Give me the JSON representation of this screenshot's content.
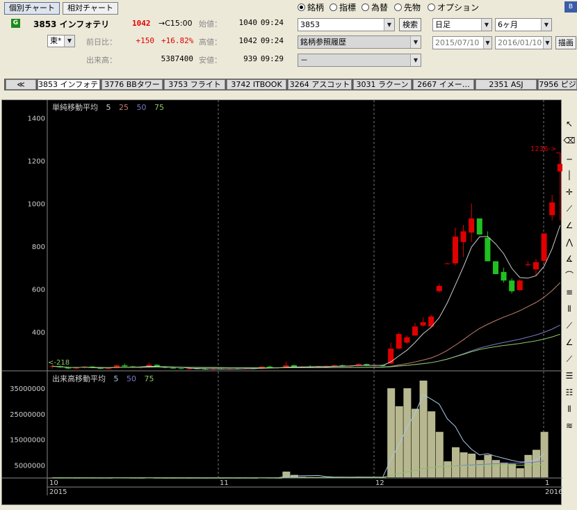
{
  "top_tabs": {
    "individual": "個別チャート",
    "relative": "相対チャート"
  },
  "stock": {
    "badge": "G",
    "code_name": "3853 インフォテリ",
    "price": "1042",
    "arrow_time": "→C15:00",
    "market": "東*",
    "change_label": "前日比：",
    "change": "+150",
    "change_pct": "+16.82%",
    "volume_label": "出来高：",
    "volume": "5387400",
    "open_label": "始値：",
    "open": "1040",
    "open_time": "09:24",
    "high_label": "高値：",
    "high": "1042",
    "high_time": "09:24",
    "low_label": "安値：",
    "low": "939",
    "low_time": "09:29"
  },
  "radios": [
    {
      "label": "銘柄",
      "on": true
    },
    {
      "label": "指標",
      "on": false
    },
    {
      "label": "為替",
      "on": false
    },
    {
      "label": "先物",
      "on": false
    },
    {
      "label": "オプション",
      "on": false
    }
  ],
  "code_input": "3853",
  "search_button": "検索",
  "history_select": "銘柄参照履歴",
  "sub_select": "－",
  "period_select": "日足",
  "range_select": "6ヶ月",
  "from_date": "2015/07/10",
  "to_date": "2016/01/10",
  "draw_button": "描画",
  "right_btn": "B",
  "stock_tabs": [
    "≪",
    "3853 インフォテリ",
    "3776 BBタワー",
    "3753 フライト",
    "3742 ITBOOK",
    "3264 アスコット",
    "3031 ラクーン",
    "2667 イメー…",
    "2351 ASJ",
    "7956 ピジ"
  ],
  "price_chart": {
    "title": "単純移動平均",
    "ma": [
      {
        "label": "5",
        "color": "#cccccc"
      },
      {
        "label": "25",
        "color": "#c08070"
      },
      {
        "label": "50",
        "color": "#7a7ac8"
      },
      {
        "label": "75",
        "color": "#8fc86a"
      }
    ],
    "y_ticks": [
      "1400",
      "1200",
      "1000",
      "800",
      "600",
      "400"
    ],
    "marker_high": "1236->",
    "marker_low": "<-218"
  },
  "volume_chart": {
    "title": "出来高移動平均",
    "ma": [
      {
        "label": "5",
        "color": "#a8c8e8"
      },
      {
        "label": "50",
        "color": "#7a7ac8"
      },
      {
        "label": "75",
        "color": "#8fc86a"
      }
    ],
    "y_ticks": [
      "35000000",
      "25000000",
      "15000000",
      "5000000"
    ]
  },
  "x_axis": {
    "months": [
      "10",
      "11",
      "12",
      "1"
    ],
    "years": [
      "2015",
      "2016"
    ]
  },
  "chart_data": [
    {
      "type": "candlestick",
      "title": "単純移動平均",
      "ylim": [
        218,
        1450
      ],
      "candles": [
        {
          "o": 237,
          "h": 246,
          "l": 228,
          "c": 240
        },
        {
          "o": 240,
          "h": 243,
          "l": 232,
          "c": 234
        },
        {
          "o": 234,
          "h": 238,
          "l": 226,
          "c": 229
        },
        {
          "o": 229,
          "h": 236,
          "l": 225,
          "c": 233
        },
        {
          "o": 233,
          "h": 240,
          "l": 230,
          "c": 238
        },
        {
          "o": 238,
          "h": 240,
          "l": 231,
          "c": 232
        },
        {
          "o": 232,
          "h": 236,
          "l": 226,
          "c": 228
        },
        {
          "o": 228,
          "h": 233,
          "l": 224,
          "c": 231
        },
        {
          "o": 231,
          "h": 246,
          "l": 229,
          "c": 244
        },
        {
          "o": 244,
          "h": 252,
          "l": 236,
          "c": 239
        },
        {
          "o": 239,
          "h": 242,
          "l": 231,
          "c": 233
        },
        {
          "o": 233,
          "h": 238,
          "l": 228,
          "c": 236
        },
        {
          "o": 236,
          "h": 258,
          "l": 233,
          "c": 246
        },
        {
          "o": 246,
          "h": 250,
          "l": 235,
          "c": 238
        },
        {
          "o": 238,
          "h": 241,
          "l": 230,
          "c": 232
        },
        {
          "o": 232,
          "h": 236,
          "l": 227,
          "c": 230
        },
        {
          "o": 230,
          "h": 234,
          "l": 225,
          "c": 227
        },
        {
          "o": 227,
          "h": 232,
          "l": 223,
          "c": 229
        },
        {
          "o": 229,
          "h": 232,
          "l": 225,
          "c": 227
        },
        {
          "o": 227,
          "h": 231,
          "l": 223,
          "c": 225
        },
        {
          "o": 225,
          "h": 230,
          "l": 222,
          "c": 228
        },
        {
          "o": 228,
          "h": 232,
          "l": 224,
          "c": 226
        },
        {
          "o": 226,
          "h": 230,
          "l": 222,
          "c": 229
        },
        {
          "o": 229,
          "h": 233,
          "l": 225,
          "c": 227
        },
        {
          "o": 227,
          "h": 232,
          "l": 224,
          "c": 230
        },
        {
          "o": 230,
          "h": 234,
          "l": 226,
          "c": 228
        },
        {
          "o": 228,
          "h": 240,
          "l": 225,
          "c": 238
        },
        {
          "o": 238,
          "h": 242,
          "l": 230,
          "c": 232
        },
        {
          "o": 232,
          "h": 236,
          "l": 228,
          "c": 234
        },
        {
          "o": 234,
          "h": 262,
          "l": 230,
          "c": 244
        },
        {
          "o": 244,
          "h": 248,
          "l": 232,
          "c": 234
        },
        {
          "o": 234,
          "h": 240,
          "l": 230,
          "c": 238
        },
        {
          "o": 238,
          "h": 244,
          "l": 233,
          "c": 236
        },
        {
          "o": 236,
          "h": 241,
          "l": 230,
          "c": 239
        },
        {
          "o": 239,
          "h": 243,
          "l": 234,
          "c": 241
        },
        {
          "o": 241,
          "h": 247,
          "l": 236,
          "c": 244
        },
        {
          "o": 244,
          "h": 248,
          "l": 238,
          "c": 240
        },
        {
          "o": 240,
          "h": 244,
          "l": 234,
          "c": 242
        },
        {
          "o": 242,
          "h": 254,
          "l": 240,
          "c": 250
        },
        {
          "o": 250,
          "h": 252,
          "l": 240,
          "c": 242
        },
        {
          "o": 242,
          "h": 246,
          "l": 238,
          "c": 245
        },
        {
          "o": 245,
          "h": 247,
          "l": 238,
          "c": 240
        },
        {
          "o": 252,
          "h": 350,
          "l": 250,
          "c": 322
        },
        {
          "o": 322,
          "h": 398,
          "l": 318,
          "c": 390
        },
        {
          "o": 350,
          "h": 383,
          "l": 345,
          "c": 375
        },
        {
          "o": 383,
          "h": 442,
          "l": 380,
          "c": 425
        },
        {
          "o": 430,
          "h": 468,
          "l": 425,
          "c": 445
        },
        {
          "o": 425,
          "h": 480,
          "l": 420,
          "c": 472
        },
        {
          "o": 590,
          "h": 625,
          "l": 585,
          "c": 615
        },
        {
          "o": 720,
          "h": 723,
          "l": 717,
          "c": 720
        },
        {
          "o": 720,
          "h": 887,
          "l": 710,
          "c": 845
        },
        {
          "o": 820,
          "h": 900,
          "l": 750,
          "c": 870
        },
        {
          "o": 864,
          "h": 1000,
          "l": 820,
          "c": 930
        },
        {
          "o": 930,
          "h": 920,
          "l": 855,
          "c": 855
        },
        {
          "o": 840,
          "h": 870,
          "l": 730,
          "c": 730
        },
        {
          "o": 730,
          "h": 730,
          "l": 670,
          "c": 670
        },
        {
          "o": 680,
          "h": 700,
          "l": 630,
          "c": 640
        },
        {
          "o": 640,
          "h": 650,
          "l": 580,
          "c": 590
        },
        {
          "o": 595,
          "h": 645,
          "l": 590,
          "c": 640
        },
        {
          "o": 715,
          "h": 730,
          "l": 705,
          "c": 715
        },
        {
          "o": 692,
          "h": 740,
          "l": 660,
          "c": 726
        },
        {
          "o": 732,
          "h": 860,
          "l": 720,
          "c": 860
        },
        {
          "o": 945,
          "h": 1040,
          "l": 920,
          "c": 1005
        },
        {
          "o": 1150,
          "h": 1236,
          "l": 920,
          "c": 1185
        }
      ],
      "sma5_end": [
        880
      ],
      "sma25_end": [
        580
      ],
      "sma50_end": [
        410
      ],
      "sma75_end": [
        350
      ]
    },
    {
      "type": "bar",
      "title": "出来高移動平均",
      "ylim": [
        0,
        38000000
      ],
      "values": [
        100000,
        80000,
        90000,
        70000,
        90000,
        80000,
        75000,
        70000,
        150000,
        120000,
        80000,
        70000,
        200000,
        80000,
        60000,
        50000,
        60000,
        50000,
        60000,
        50000,
        60000,
        50000,
        60000,
        50000,
        60000,
        50000,
        200000,
        100000,
        60000,
        2500000,
        1200000,
        500000,
        400000,
        300000,
        400000,
        300000,
        400000,
        300000,
        500000,
        300000,
        400000,
        200000,
        35000000,
        28000000,
        35000000,
        27000000,
        38000000,
        26000000,
        18000000,
        6500000,
        12000000,
        10000000,
        9500000,
        7000000,
        9000000,
        7000000,
        6000000,
        5500000,
        3800000,
        9000000,
        11000000,
        18000000
      ]
    }
  ]
}
